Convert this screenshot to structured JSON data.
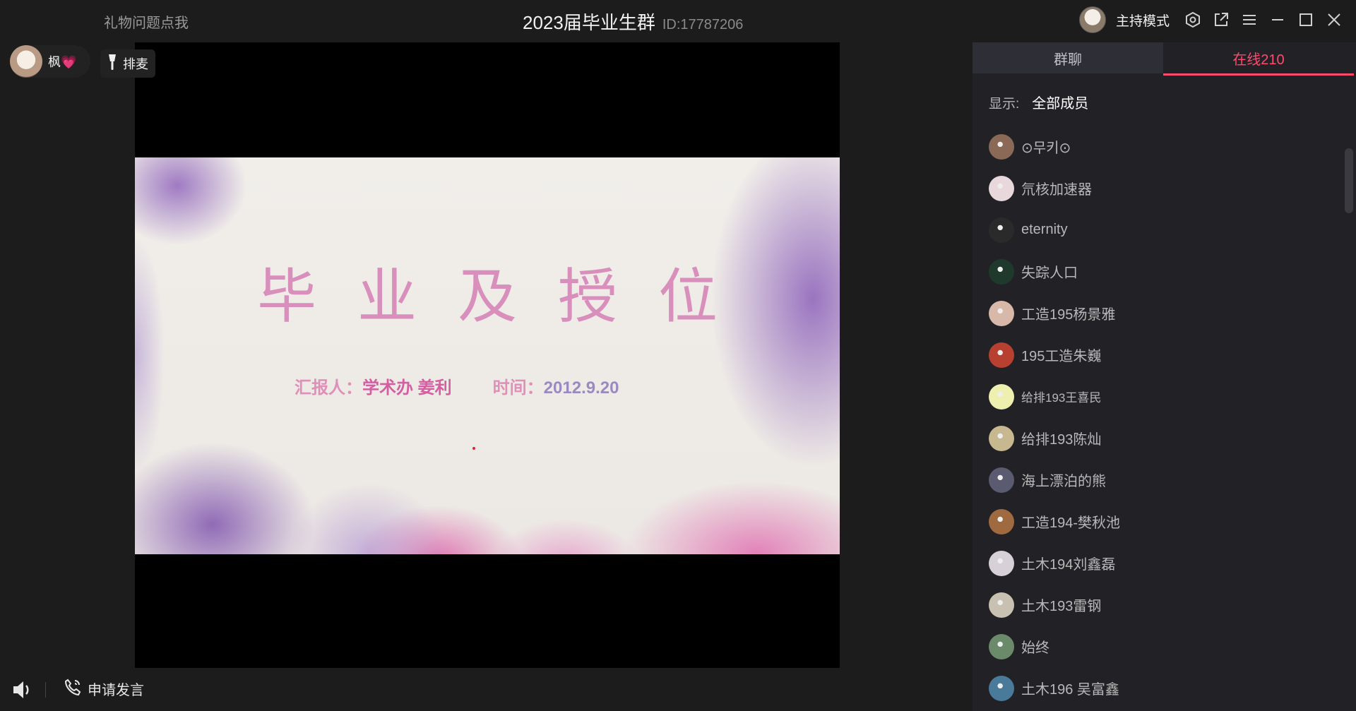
{
  "titlebar": {
    "gift_link": "礼物问题点我",
    "room_title": "2023届毕业生群",
    "room_id": "ID:17787206",
    "host_mode": "主持模式",
    "icons": [
      "settings-icon",
      "popout-icon",
      "menu-icon",
      "minimize-icon",
      "maximize-icon",
      "close-icon"
    ]
  },
  "stage": {
    "speaker_name": "枫💗",
    "queue_label": "排麦",
    "slide": {
      "title": "毕业及授位",
      "reporter_label": "汇报人：",
      "reporter_value": "学术办 姜利",
      "time_label": "时间：",
      "time_value": "2012.9.20"
    }
  },
  "bottom": {
    "apply_label": "申请发言"
  },
  "panel": {
    "tabs": [
      {
        "label": "群聊",
        "active": false
      },
      {
        "label": "在线210",
        "active": true
      }
    ],
    "filter_label": "显示:",
    "filter_value": "全部成员",
    "members": [
      {
        "name": "⊙무키⊙",
        "color": "#8a6a56"
      },
      {
        "name": "氘核加速器",
        "color": "#e8d8dc"
      },
      {
        "name": "eternity",
        "color": "#2a2a2a"
      },
      {
        "name": "失踪人口",
        "color": "#1f3a2c"
      },
      {
        "name": "工造195杨景雅",
        "color": "#d8b8a8"
      },
      {
        "name": "195工造朱巍",
        "color": "#b84030"
      },
      {
        "name": "给排193王喜民",
        "color": "#eef0b0"
      },
      {
        "name": "给排193陈灿",
        "color": "#c8b890"
      },
      {
        "name": "海上漂泊的熊",
        "color": "#5a5a70"
      },
      {
        "name": "工造194-樊秋池",
        "color": "#a06a40"
      },
      {
        "name": "土木194刘鑫磊",
        "color": "#d8d0d8"
      },
      {
        "name": "土木193雷钢",
        "color": "#c8c0b0"
      },
      {
        "name": "始终",
        "color": "#6a8a6a"
      },
      {
        "name": "土木196 吴富鑫",
        "color": "#4a7a9a"
      }
    ]
  },
  "colors": {
    "accent": "#ff4a6e",
    "background": "#1c1c1c",
    "panel": "#222226"
  }
}
